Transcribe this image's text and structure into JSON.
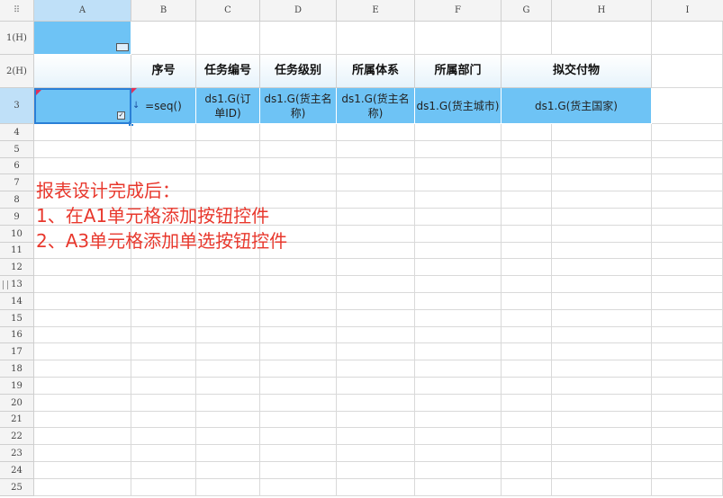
{
  "columns": [
    "A",
    "B",
    "C",
    "D",
    "E",
    "F",
    "G",
    "H",
    "I"
  ],
  "rows": [
    "1(H)",
    "2(H)",
    "3",
    "4",
    "5",
    "6",
    "7",
    "8",
    "9",
    "10",
    "11",
    "12",
    "13",
    "14",
    "15",
    "16",
    "17",
    "18",
    "19",
    "20",
    "21",
    "22",
    "23",
    "24",
    "25"
  ],
  "header_row": {
    "b2": "序号",
    "c2": "任务编号",
    "d2": "任务级别",
    "e2": "所属体系",
    "f2": "所属部门",
    "gh2": "拟交付物"
  },
  "data_row": {
    "b3": "=seq()",
    "c3": "ds1.G(订单ID)",
    "d3": "ds1.G(货主名称)",
    "e3": "ds1.G(货主名称)",
    "f3": "ds1.G(货主城市)",
    "gh3": "ds1.G(货主国家)"
  },
  "annotation": {
    "line1": "报表设计完成后：",
    "line2": "1、在A1单元格添加按钮控件",
    "line3": "2、A3单元格添加单选按钮控件"
  },
  "colors": {
    "cell_blue": "#6ec3f5",
    "annotation_red": "#e8382d",
    "selected_header": "#bfe0f8"
  }
}
